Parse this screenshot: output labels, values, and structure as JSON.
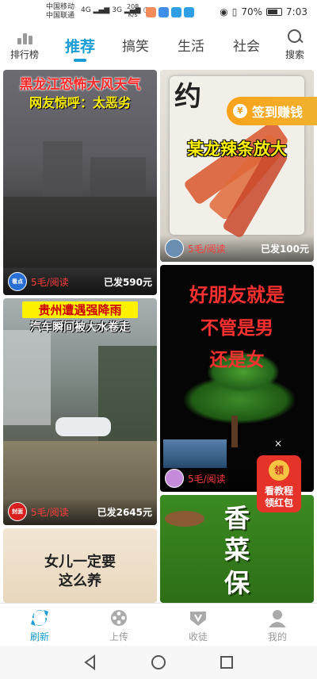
{
  "status_bar": {
    "carrier_1": "中国移动",
    "carrier_2": "中国联通",
    "network_1": "4G",
    "network_2": "3G",
    "speed_value": "208",
    "speed_unit": "K/s",
    "battery": "70%",
    "time": "7:03"
  },
  "top_nav": {
    "left_label": "排行榜",
    "right_label": "搜索",
    "tabs": [
      "推荐",
      "搞笑",
      "生活",
      "社会"
    ],
    "active_tab": "推荐"
  },
  "feed": {
    "cards": [
      {
        "overlay_line1": "黑龙江恐怖大风天气",
        "overlay_line2": "网友惊呼：太恶劣",
        "source": "看点",
        "rate": "5毛/阅读",
        "sent": "已发590元"
      },
      {
        "overlay_main": "某龙辣条放大",
        "package_text": "约",
        "rate": "5毛/阅读",
        "sent": "已发100元"
      },
      {
        "overlay_line1": "贵州遭遇强降雨",
        "overlay_line2": "汽车瞬间被大水卷走",
        "source": "封面",
        "rate": "5毛/阅读",
        "sent": "已发2645元"
      },
      {
        "overlay_line1": "好朋友就是",
        "overlay_line2": "不管是男",
        "overlay_line3": "还是女",
        "rate": "5毛/阅读"
      },
      {
        "overlay_line1": "女儿一定要",
        "overlay_line2": "这么养"
      },
      {
        "overlay_line1": "香",
        "overlay_line2": "菜",
        "overlay_line3": "保"
      }
    ]
  },
  "floating": {
    "checkin_label": "签到赚钱",
    "checkin_coin": "¥",
    "redpack_badge": "领",
    "redpack_line1": "看教程",
    "redpack_line2": "领红包",
    "close": "×"
  },
  "bottom_nav": {
    "items": [
      "刷新",
      "上传",
      "收徒",
      "我的"
    ],
    "active": "刷新"
  },
  "colors": {
    "accent": "#1a9cd4",
    "rate": "#ff3b3b",
    "checkin": "#f5a623"
  }
}
